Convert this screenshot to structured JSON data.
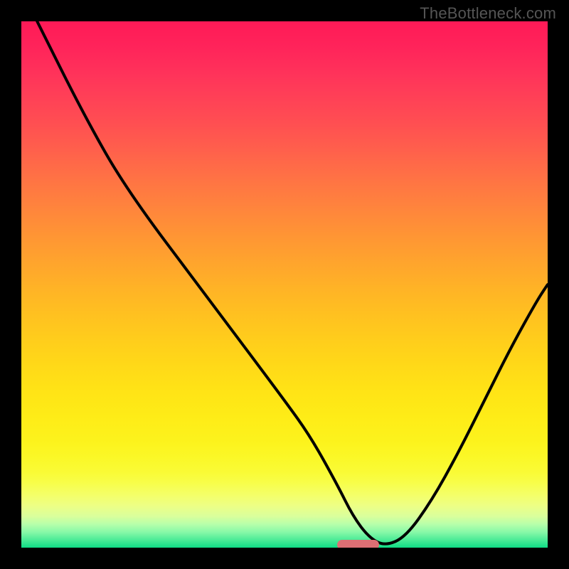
{
  "watermark": "TheBottleneck.com",
  "chart_data": {
    "type": "line",
    "title": "",
    "xlabel": "",
    "ylabel": "",
    "xlim": [
      0,
      100
    ],
    "ylim": [
      0,
      100
    ],
    "x": [
      3,
      12,
      20,
      35,
      50,
      55,
      60,
      63,
      66,
      69,
      73,
      78,
      83,
      88,
      93,
      98,
      100
    ],
    "values": [
      100,
      82,
      68,
      48,
      28,
      21,
      12,
      6,
      2,
      0.3,
      2,
      9,
      18,
      28,
      38,
      47,
      50
    ],
    "marker": {
      "x_start": 60,
      "x_end": 68,
      "y": 0.5,
      "color": "#dd6f74"
    },
    "gradient_stops": [
      {
        "y": 100,
        "color": "#ff1a57"
      },
      {
        "y": 95,
        "color": "#ff245a"
      },
      {
        "y": 90,
        "color": "#ff335a"
      },
      {
        "y": 85,
        "color": "#ff4256"
      },
      {
        "y": 80,
        "color": "#ff5151"
      },
      {
        "y": 75,
        "color": "#ff624b"
      },
      {
        "y": 70,
        "color": "#ff7344"
      },
      {
        "y": 65,
        "color": "#ff833d"
      },
      {
        "y": 60,
        "color": "#ff9335"
      },
      {
        "y": 55,
        "color": "#ffa22e"
      },
      {
        "y": 50,
        "color": "#ffb127"
      },
      {
        "y": 45,
        "color": "#ffbf21"
      },
      {
        "y": 40,
        "color": "#ffcc1c"
      },
      {
        "y": 35,
        "color": "#ffd818"
      },
      {
        "y": 30,
        "color": "#ffe316"
      },
      {
        "y": 25,
        "color": "#feec17"
      },
      {
        "y": 20,
        "color": "#fcf31d"
      },
      {
        "y": 17,
        "color": "#fbf828"
      },
      {
        "y": 14,
        "color": "#f9fb38"
      },
      {
        "y": 12,
        "color": "#f7fe4e"
      },
      {
        "y": 10,
        "color": "#f4ff69"
      },
      {
        "y": 8,
        "color": "#edff85"
      },
      {
        "y": 6,
        "color": "#d9ff9c"
      },
      {
        "y": 4.5,
        "color": "#b7ffaa"
      },
      {
        "y": 3,
        "color": "#88f9a8"
      },
      {
        "y": 1.5,
        "color": "#4ceb97"
      },
      {
        "y": 0,
        "color": "#0fdc85"
      }
    ]
  },
  "colors": {
    "curve": "#000000",
    "bg": "#000000"
  }
}
